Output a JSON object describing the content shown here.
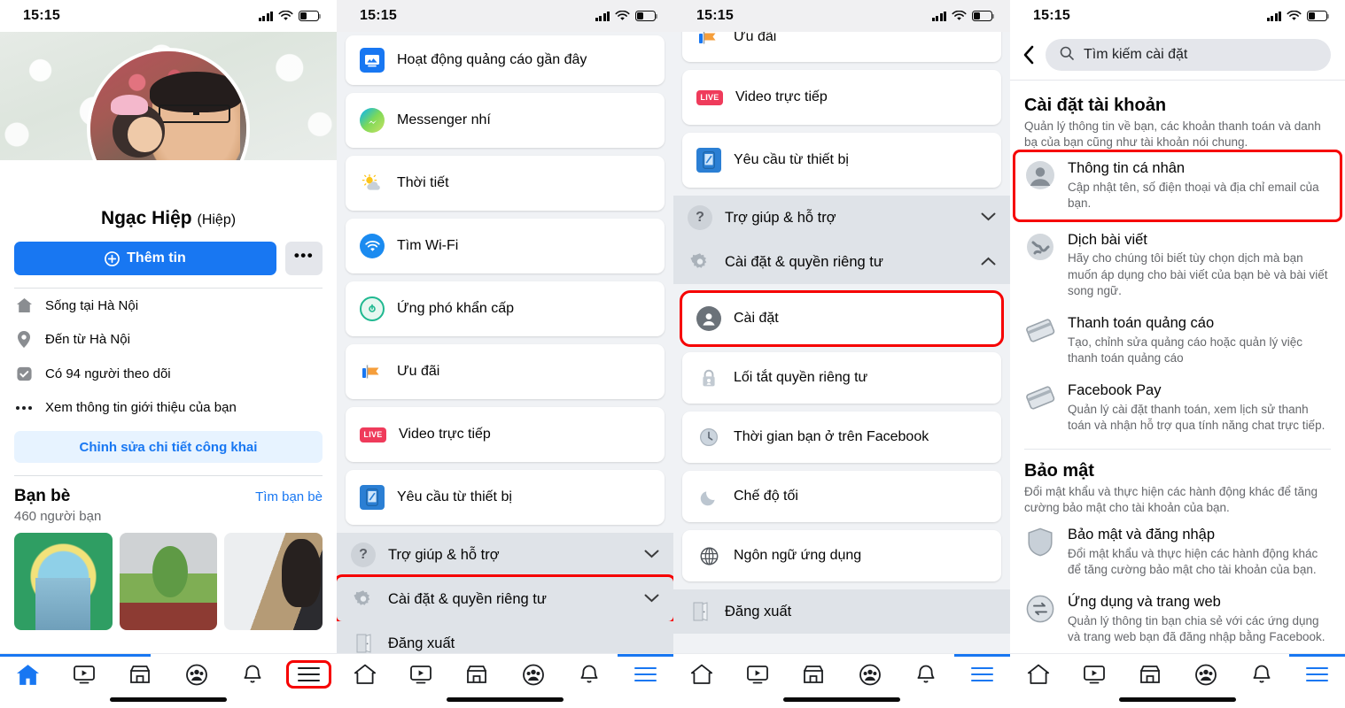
{
  "status_bar": {
    "time": "15:15",
    "signal_icon": "cellular-signal-icon",
    "wifi_icon": "wifi-icon",
    "battery_icon": "battery-icon"
  },
  "panel1_profile": {
    "name": "Ngạc Hiệp",
    "nickname": "(Hiệp)",
    "camera_badge_icon": "camera-icon",
    "add_story_button": "Thêm tin",
    "more_button": "•••",
    "info_rows": [
      {
        "icon": "home-icon",
        "text": "Sống tại Hà Nội"
      },
      {
        "icon": "location-pin-icon",
        "text": "Đến từ Hà Nội"
      },
      {
        "icon": "followers-icon",
        "text": "Có 94 người theo dõi"
      },
      {
        "icon": "ellipsis-icon",
        "text": "Xem thông tin giới thiệu của bạn"
      }
    ],
    "edit_public_details": "Chỉnh sửa chi tiết công khai",
    "friends_title": "Bạn bè",
    "find_friends_link": "Tìm bạn bè",
    "friends_count": "460 người bạn"
  },
  "panel2_menu": {
    "cards": [
      {
        "icon": "ad-activity-icon",
        "label": "Hoạt động quảng cáo gần đây"
      },
      {
        "icon": "messenger-kids-icon",
        "label": "Messenger nhí"
      },
      {
        "icon": "weather-icon",
        "label": "Thời tiết"
      },
      {
        "icon": "wifi-icon",
        "label": "Tìm Wi-Fi"
      },
      {
        "icon": "emergency-icon",
        "label": "Ứng phó khẩn cấp"
      },
      {
        "icon": "offers-icon",
        "label": "Ưu đãi"
      },
      {
        "icon": "live-video-icon",
        "label": "Video trực tiếp"
      },
      {
        "icon": "device-request-icon",
        "label": "Yêu cầu từ thiết bị"
      }
    ],
    "sections": [
      {
        "icon": "help-icon",
        "label": "Trợ giúp & hỗ trợ",
        "chevron": "chevron-down-icon",
        "highlighted": false
      },
      {
        "icon": "gear-icon",
        "label": "Cài đặt & quyền riêng tư",
        "chevron": "chevron-down-icon",
        "highlighted": true
      }
    ],
    "logout": {
      "icon": "logout-door-icon",
      "label": "Đăng xuất"
    }
  },
  "panel3_menu_expanded": {
    "cards_top": [
      {
        "icon": "offers-icon",
        "label": "Ưu đãi"
      },
      {
        "icon": "live-video-icon",
        "label": "Video trực tiếp"
      },
      {
        "icon": "device-request-icon",
        "label": "Yêu cầu từ thiết bị"
      }
    ],
    "help_section": {
      "icon": "help-icon",
      "label": "Trợ giúp & hỗ trợ",
      "chevron": "chevron-down-icon"
    },
    "settings_section": {
      "icon": "gear-icon",
      "label": "Cài đặt & quyền riêng tư",
      "chevron": "chevron-up-icon"
    },
    "sub_items": [
      {
        "icon": "settings-person-icon",
        "label": "Cài đặt",
        "highlighted": true
      },
      {
        "icon": "privacy-lock-icon",
        "label": "Lối tắt quyền riêng tư",
        "highlighted": false
      },
      {
        "icon": "clock-icon",
        "label": "Thời gian bạn ở trên Facebook",
        "highlighted": false
      },
      {
        "icon": "moon-icon",
        "label": "Chế độ tối",
        "highlighted": false
      },
      {
        "icon": "globe-icon",
        "label": "Ngôn ngữ ứng dụng",
        "highlighted": false
      }
    ],
    "logout": {
      "icon": "logout-door-icon",
      "label": "Đăng xuất"
    }
  },
  "panel4_settings": {
    "back_icon": "chevron-left-icon",
    "search": {
      "icon": "search-icon",
      "placeholder": "Tìm kiếm cài đặt",
      "value": "Tìm kiếm cài đặt"
    },
    "section_account": {
      "title": "Cài đặt tài khoản",
      "subtitle": "Quản lý thông tin về bạn, các khoản thanh toán và danh bạ của bạn cũng như tài khoản nói chung.",
      "items": [
        {
          "icon": "person-avatar-icon",
          "title": "Thông tin cá nhân",
          "sub": "Cập nhật tên, số điện thoại và địa chỉ email của bạn.",
          "highlighted": true
        },
        {
          "icon": "globe-translate-icon",
          "title": "Dịch bài viết",
          "sub": "Hãy cho chúng tôi biết tùy chọn dịch mà bạn muốn áp dụng cho bài viết của bạn bè và bài viết song ngữ.",
          "highlighted": false
        },
        {
          "icon": "credit-card-icon",
          "title": "Thanh toán quảng cáo",
          "sub": "Tạo, chỉnh sửa quảng cáo hoặc quản lý việc thanh toán quảng cáo",
          "highlighted": false
        },
        {
          "icon": "credit-card-icon",
          "title": "Facebook Pay",
          "sub": "Quản lý cài đặt thanh toán, xem lịch sử thanh toán và nhận hỗ trợ qua tính năng chat trực tiếp.",
          "highlighted": false
        }
      ]
    },
    "section_security": {
      "title": "Bảo mật",
      "subtitle": "Đổi mật khẩu và thực hiện các hành động khác để tăng cường bảo mật cho tài khoản của bạn.",
      "items": [
        {
          "icon": "shield-icon",
          "title": "Bảo mật và đăng nhập",
          "sub": "Đổi mật khẩu và thực hiện các hành động khác để tăng cường bảo mật cho tài khoản của bạn.",
          "highlighted": false
        },
        {
          "icon": "apps-websites-icon",
          "title": "Ứng dụng và trang web",
          "sub": "Quản lý thông tin bạn chia sẻ với các ứng dụng và trang web bạn đã đăng nhập bằng Facebook.",
          "highlighted": false
        }
      ]
    }
  },
  "bottom_nav": {
    "items": [
      {
        "icon": "home-icon",
        "name": "home"
      },
      {
        "icon": "video-icon",
        "name": "watch"
      },
      {
        "icon": "marketplace-icon",
        "name": "marketplace"
      },
      {
        "icon": "groups-icon",
        "name": "groups"
      },
      {
        "icon": "bell-icon",
        "name": "notifications"
      },
      {
        "icon": "hamburger-menu-icon",
        "name": "menu"
      }
    ]
  },
  "colors": {
    "accent": "#1877f2",
    "highlight": "#f60000",
    "bg": "#f0f2f5",
    "card": "#ffffff",
    "muted": "#65676b"
  }
}
